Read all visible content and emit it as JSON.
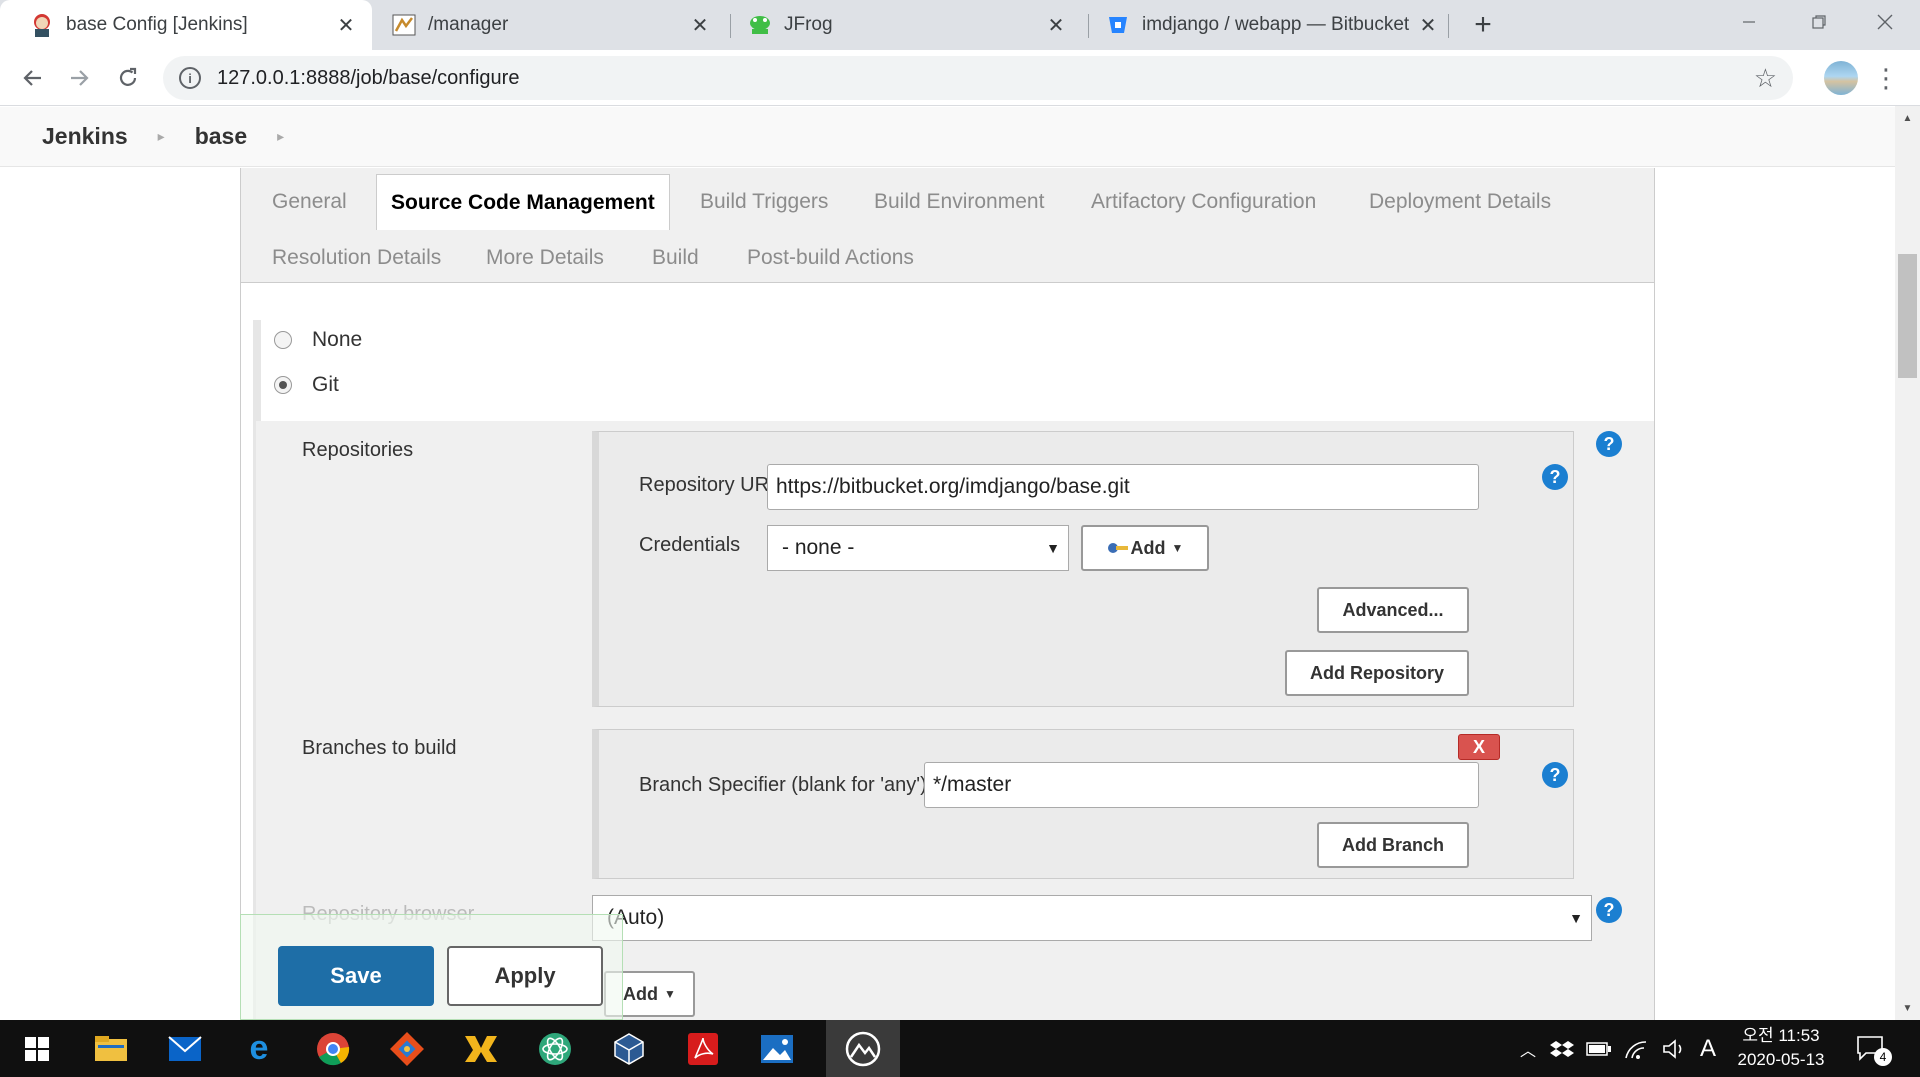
{
  "browser": {
    "tabs": [
      {
        "title": "base Config [Jenkins]",
        "icon": "jenkins-icon"
      },
      {
        "title": "/manager",
        "icon": "tomcat-icon"
      },
      {
        "title": "JFrog",
        "icon": "jfrog-icon"
      },
      {
        "title": "imdjango / webapp — Bitbucket",
        "icon": "bitbucket-icon"
      }
    ],
    "close_glyph": "✕",
    "new_tab_glyph": "+",
    "url": "127.0.0.1:8888/job/base/configure"
  },
  "breadcrumb": {
    "items": [
      "Jenkins",
      "base"
    ]
  },
  "config_tabs": {
    "row1": [
      "General",
      "Source Code Management",
      "Build Triggers",
      "Build Environment",
      "Artifactory Configuration",
      "Deployment Details"
    ],
    "row2": [
      "Resolution Details",
      "More Details",
      "Build",
      "Post-build Actions"
    ],
    "active": "Source Code Management"
  },
  "scm": {
    "options": [
      {
        "label": "None",
        "checked": false
      },
      {
        "label": "Git",
        "checked": true
      }
    ],
    "repositories_label": "Repositories",
    "repo_url_label": "Repository URL",
    "repo_url_value": "https://bitbucket.org/imdjango/base.git",
    "credentials_label": "Credentials",
    "credentials_value": "- none -",
    "add_label": "Add",
    "advanced_label": "Advanced...",
    "add_repository_label": "Add Repository",
    "branches_label": "Branches to build",
    "remove_label": "X",
    "branch_specifier_label": "Branch Specifier (blank for 'any')",
    "branch_specifier_value": "*/master",
    "add_branch_label": "Add Branch",
    "repo_browser_label": "Repository browser",
    "repo_browser_value": "(Auto)",
    "add_behaviour_label": "Add",
    "help_glyph": "?"
  },
  "actions": {
    "save_label": "Save",
    "apply_label": "Apply"
  },
  "taskbar": {
    "clock_time": "오전 11:53",
    "clock_date": "2020-05-13",
    "ime": "A",
    "notification_count": "4"
  }
}
